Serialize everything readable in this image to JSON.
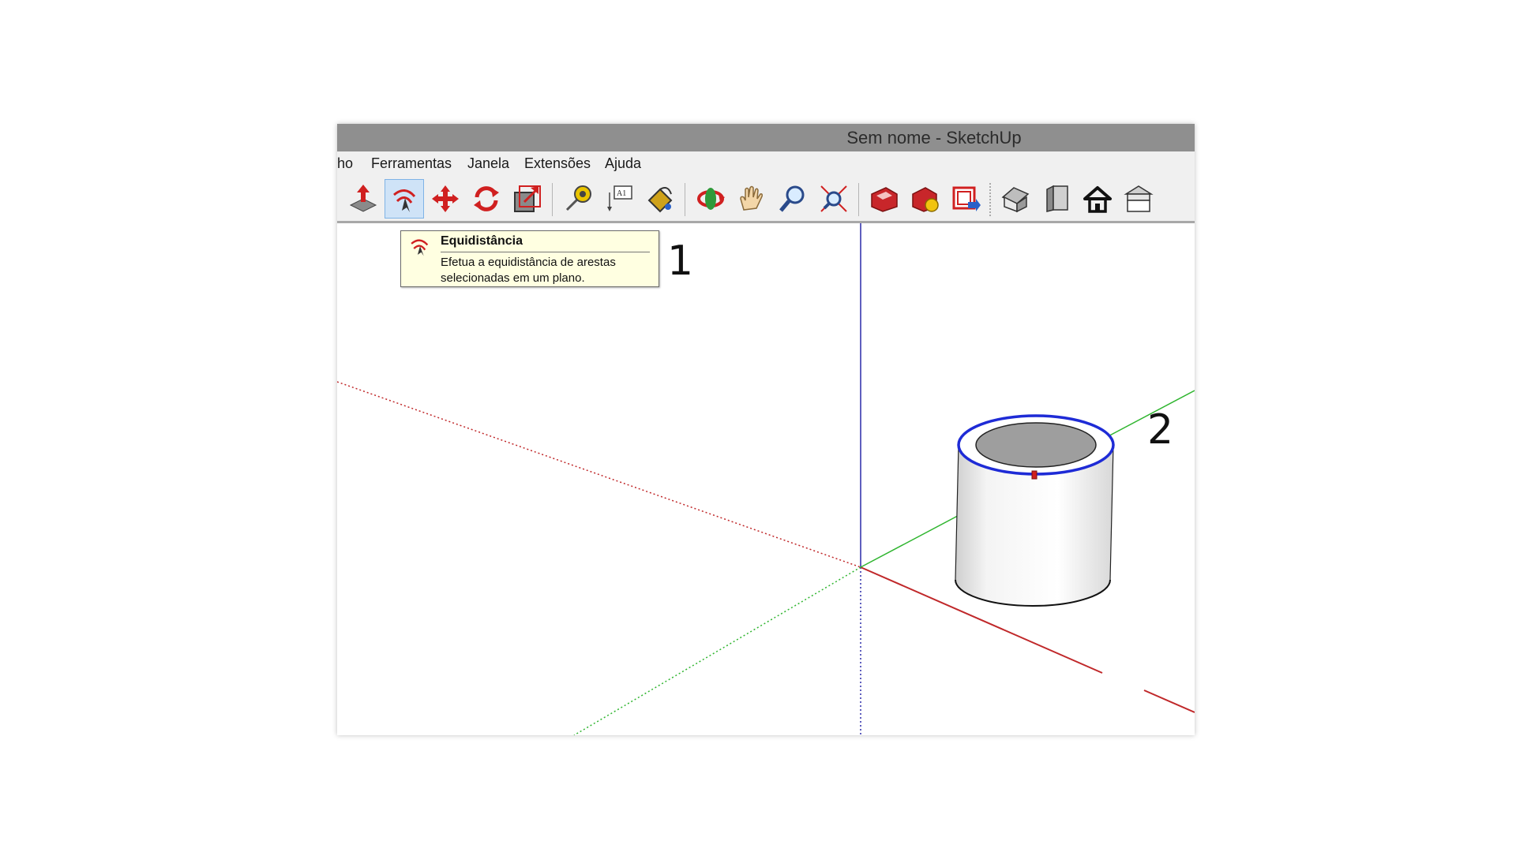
{
  "window": {
    "title": "Sem nome - SketchUp"
  },
  "menu": {
    "items": [
      "ho",
      "Ferramentas",
      "Janela",
      "Extensões",
      "Ajuda"
    ]
  },
  "toolbar": {
    "tools": [
      {
        "name": "push-pull",
        "icon": "push-pull-icon"
      },
      {
        "name": "offset",
        "icon": "offset-icon",
        "active": true
      },
      {
        "name": "move",
        "icon": "move-icon"
      },
      {
        "name": "rotate",
        "icon": "rotate-icon"
      },
      {
        "name": "scale",
        "icon": "scale-icon"
      },
      {
        "name": "tape-measure",
        "icon": "tape-measure-icon"
      },
      {
        "name": "text",
        "icon": "text-icon"
      },
      {
        "name": "paint-bucket",
        "icon": "paint-bucket-icon"
      },
      {
        "name": "orbit",
        "icon": "orbit-icon"
      },
      {
        "name": "pan",
        "icon": "pan-hand-icon"
      },
      {
        "name": "zoom",
        "icon": "zoom-icon"
      },
      {
        "name": "zoom-extents",
        "icon": "zoom-extents-icon"
      },
      {
        "name": "3d-warehouse",
        "icon": "warehouse-icon"
      },
      {
        "name": "extension-warehouse",
        "icon": "extension-warehouse-icon"
      },
      {
        "name": "layout-send",
        "icon": "layout-send-icon"
      },
      {
        "name": "iso-view",
        "icon": "iso-house-icon"
      },
      {
        "name": "front-view",
        "icon": "front-view-icon"
      },
      {
        "name": "home-view",
        "icon": "home-icon"
      },
      {
        "name": "top-view",
        "icon": "top-house-icon"
      }
    ]
  },
  "tooltip": {
    "title": "Equidistância",
    "line1": "Efetua a equidistância de arestas",
    "line2": "selecionadas em um plano."
  },
  "markers": {
    "one": "1",
    "two": "2"
  },
  "colors": {
    "titlebar": "#8f8f8f",
    "red_axis": "#c0282a",
    "green_axis": "#2fb52f",
    "blue_axis": "#2a2aa8",
    "selection": "#1e2bd6",
    "tooltip_bg": "#ffffe1"
  }
}
